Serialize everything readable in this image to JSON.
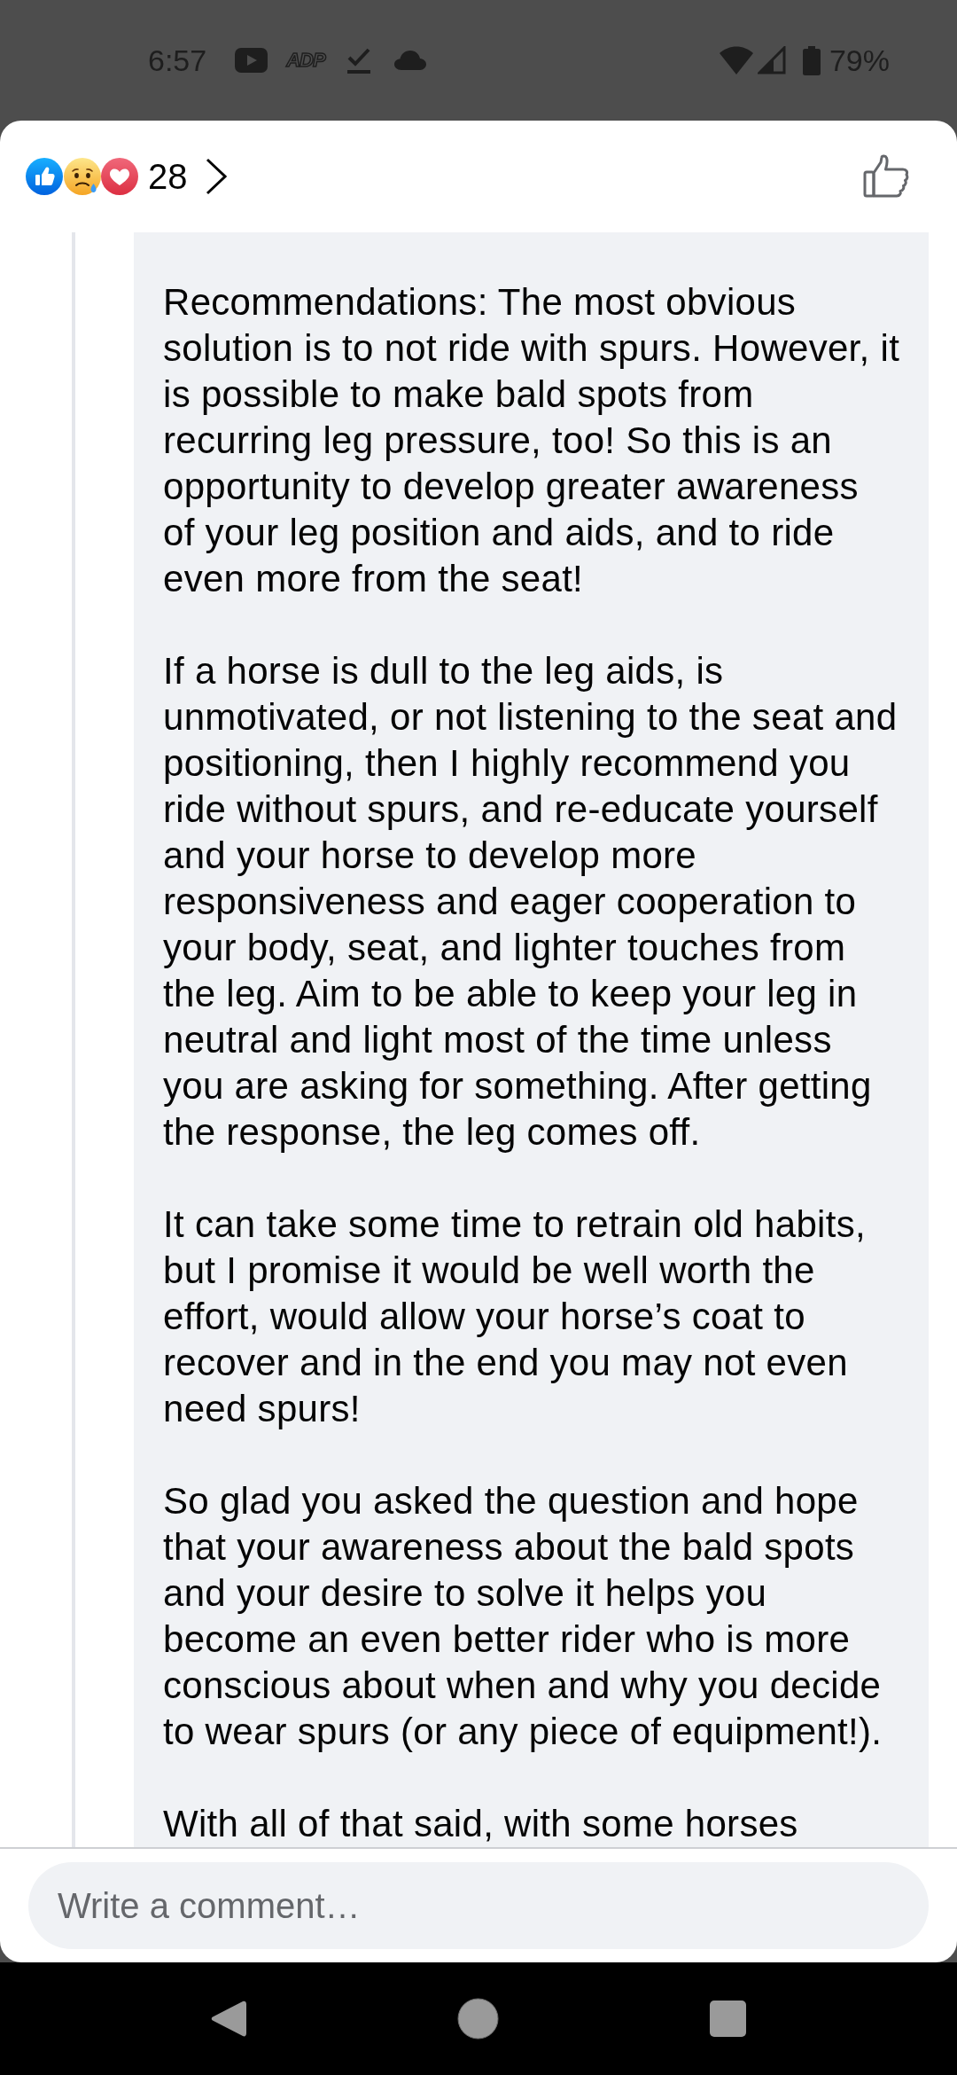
{
  "status_bar": {
    "time": "6:57",
    "app_logo": "ADP",
    "battery": "79%"
  },
  "reactions_header": {
    "count": "28",
    "liked": false
  },
  "comment": {
    "paragraphs": [
      "Recommendations: The most obvious solution is to not ride with spurs. However, it is possible to make bald spots from recurring leg pressure, too! So this is an opportunity to develop greater awareness of your leg position and aids, and to ride even more from the seat!",
      "If a horse is dull to the leg aids, is unmotivated, or not listening to the seat and positioning, then I highly recommend you ride without spurs, and re-educate yourself and your horse to develop more responsiveness and eager cooperation to your body, seat, and lighter touches from the leg. Aim to be able to keep your leg in neutral and light most of the time unless you are asking for something. After getting the response, the leg comes off.",
      "It can take some time to retrain old habits, but I promise it would be well worth the effort, would allow your horse’s coat to recover and in the end you may not even need spurs!",
      "So glad you asked the question and hope that your awareness about the bald spots and your desire to solve it helps you become an even better rider who is more conscious about when and why you decide to wear spurs (or any piece of equipment!).",
      "With all of that said, with some horses"
    ]
  },
  "composer": {
    "placeholder": "Write a comment…"
  }
}
